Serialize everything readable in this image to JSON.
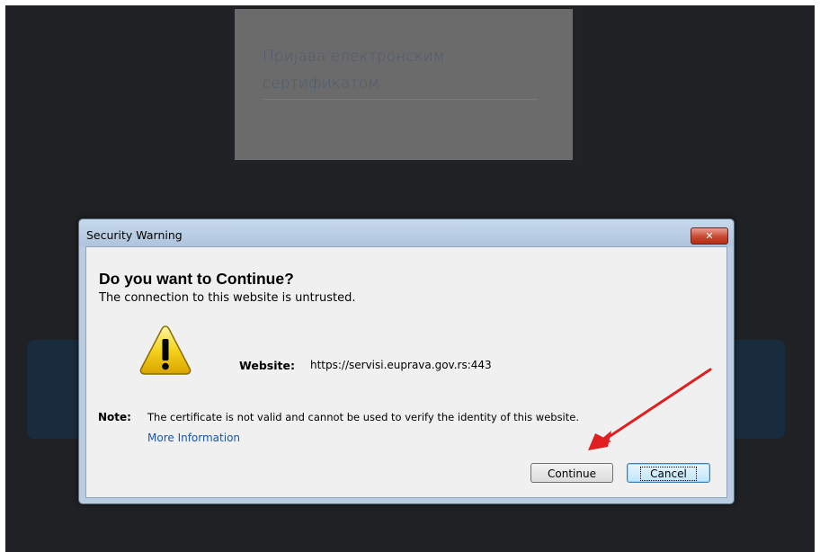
{
  "login_card": {
    "title": "Пријава електронским сертификатом"
  },
  "dialog": {
    "title": "Security Warning",
    "close_label": "✕",
    "heading": "Do you want to Continue?",
    "subheading": "The connection to this website is untrusted.",
    "website_label": "Website:",
    "website_value": "https://servisi.euprava.gov.rs:443",
    "note_label": "Note:",
    "note_text": "The certificate is not valid and cannot be used to verify the identity of this website.",
    "more_info": "More Information",
    "continue_label": "Continue",
    "cancel_label": "Cancel"
  },
  "icons": {
    "warning": "warning-triangle-icon",
    "arrow": "red-arrow-annotation"
  },
  "colors": {
    "backdrop": "#1f2124",
    "title_bar": "#b9cde2",
    "link": "#1a56a6",
    "arrow": "#e02020",
    "warning_yellow": "#f5d31c"
  }
}
